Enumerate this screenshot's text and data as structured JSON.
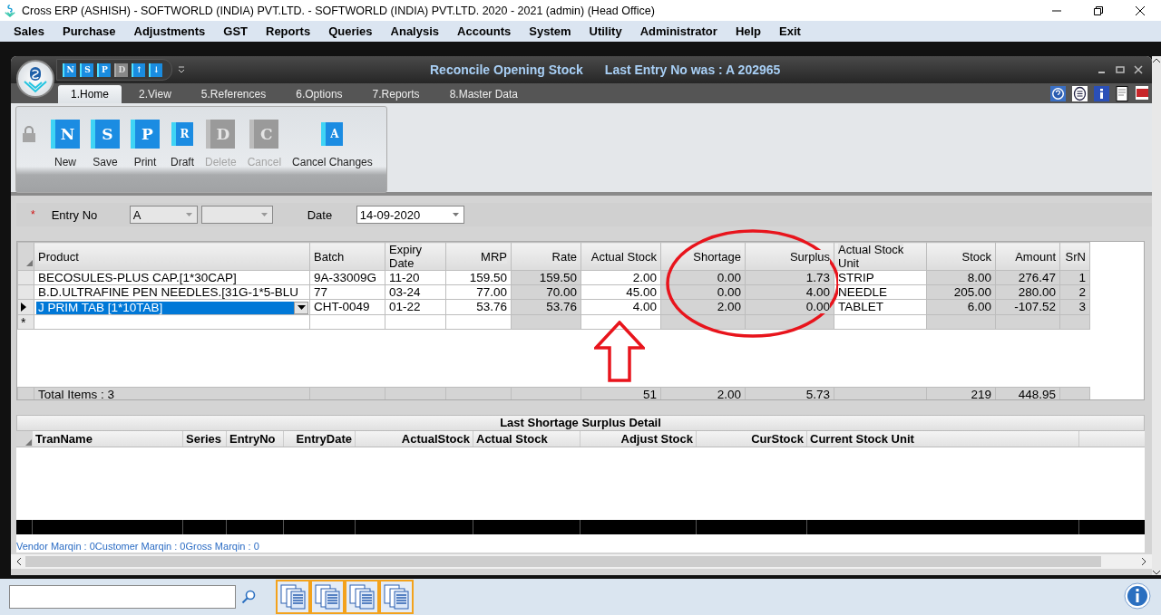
{
  "window": {
    "title": "Cross ERP (ASHISH) - SOFTWORLD (INDIA) PVT.LTD. - SOFTWORLD (INDIA) PVT.LTD.  2020 - 2021 (admin) (Head Office)"
  },
  "menu": [
    "Sales",
    "Purchase",
    "Adjustments",
    "GST",
    "Reports",
    "Queries",
    "Analysis",
    "Accounts",
    "System",
    "Utility",
    "Administrator",
    "Help",
    "Exit"
  ],
  "form_window": {
    "title": "Reconcile Opening Stock",
    "last_entry": "Last Entry No was : A 202965"
  },
  "quick_toolbar": [
    {
      "glyph": "N",
      "disabled": false
    },
    {
      "glyph": "S",
      "disabled": false
    },
    {
      "glyph": "P",
      "disabled": false
    },
    {
      "glyph": "D",
      "disabled": true
    },
    {
      "glyph": "↑",
      "disabled": false
    },
    {
      "glyph": "↓",
      "disabled": false
    }
  ],
  "tabs": [
    {
      "label": "1.Home",
      "selected": true
    },
    {
      "label": "2.View",
      "selected": false
    },
    {
      "label": "5.References",
      "selected": false
    },
    {
      "label": "6.Options",
      "selected": false
    },
    {
      "label": "7.Reports",
      "selected": false
    },
    {
      "label": "8.Master Data",
      "selected": false
    }
  ],
  "ribbon_buttons": [
    {
      "label": "New",
      "glyph": "N",
      "disabled": false
    },
    {
      "label": "Save",
      "glyph": "S",
      "disabled": false
    },
    {
      "label": "Print",
      "glyph": "P",
      "disabled": false
    },
    {
      "label": "Draft",
      "glyph": "R",
      "disabled": false
    },
    {
      "label": "Delete",
      "glyph": "D",
      "disabled": true
    },
    {
      "label": "Cancel",
      "glyph": "C",
      "disabled": true
    },
    {
      "label": "Cancel Changes",
      "glyph": "A",
      "disabled": false
    }
  ],
  "entry": {
    "required_mark": "*",
    "label": "Entry No",
    "series": "A",
    "date_label": "Date",
    "date": "14-09-2020"
  },
  "grid": {
    "columns": [
      {
        "label": "Product",
        "kind": "text"
      },
      {
        "label": "Batch",
        "kind": "text"
      },
      {
        "label": "Expiry Date",
        "kind": "text"
      },
      {
        "label": "MRP",
        "kind": "number"
      },
      {
        "label": "Rate",
        "kind": "computed"
      },
      {
        "label": "Actual Stock",
        "kind": "number"
      },
      {
        "label": "Shortage",
        "kind": "computed"
      },
      {
        "label": "Surplus",
        "kind": "computed"
      },
      {
        "label": "Actual Stock Unit",
        "kind": "text"
      },
      {
        "label": "Stock",
        "kind": "computed"
      },
      {
        "label": "Amount",
        "kind": "computed"
      },
      {
        "label": "SrN",
        "kind": "computed"
      }
    ],
    "rows": [
      {
        "selected": false,
        "cells": [
          "BECOSULES-PLUS CAP.[1*30CAP]",
          "9A-33009G",
          "11-20",
          "159.50",
          "159.50",
          "2.00",
          "0.00",
          "1.73",
          "STRIP",
          "8.00",
          "276.47",
          "1"
        ]
      },
      {
        "selected": false,
        "cells": [
          "B.D.ULTRAFINE PEN NEEDLES.[31G-1*5-BLU",
          "77",
          "03-24",
          "77.00",
          "70.00",
          "45.00",
          "0.00",
          "4.00",
          "NEEDLE",
          "205.00",
          "280.00",
          "2"
        ]
      },
      {
        "selected": true,
        "cells": [
          "J PRIM TAB [1*10TAB]",
          "CHT-0049",
          "01-22",
          "53.76",
          "53.76",
          "4.00",
          "2.00",
          "0.00",
          "TABLET",
          "6.00",
          "-107.52",
          "3"
        ]
      }
    ],
    "new_row_marker": "*",
    "totals": {
      "label": "Total Items : 3",
      "cells": [
        null,
        null,
        null,
        null,
        "51",
        "2.00",
        "5.73",
        null,
        "219",
        "448.95",
        null
      ]
    }
  },
  "detail": {
    "title": "Last Shortage Surplus Detail",
    "columns": [
      {
        "label": "TranName",
        "kind": "text"
      },
      {
        "label": "Series",
        "kind": "text"
      },
      {
        "label": "EntryNo",
        "kind": "text"
      },
      {
        "label": "EntryDate",
        "kind": "number"
      },
      {
        "label": "ActualStock",
        "kind": "number"
      },
      {
        "label": "Actual Stock",
        "kind": "text"
      },
      {
        "label": "Adjust Stock",
        "kind": "number"
      },
      {
        "label": "CurStock",
        "kind": "number"
      },
      {
        "label": "Current Stock Unit",
        "kind": "text"
      }
    ]
  },
  "status": "Vendor Marqin : 0Customer Marqin : 0Gross Marqin : 0"
}
